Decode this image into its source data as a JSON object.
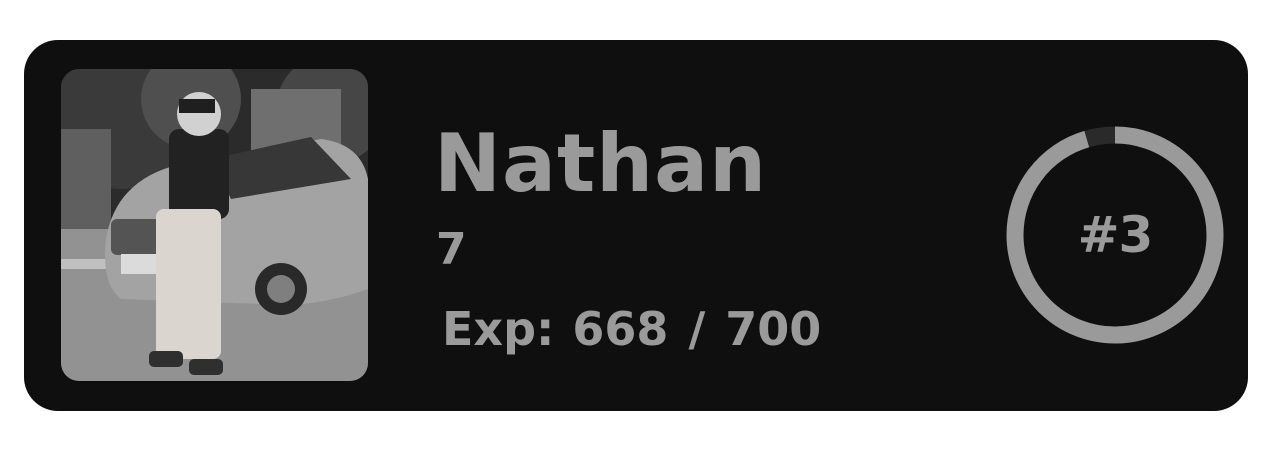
{
  "profile": {
    "name": "Nathan",
    "level": "7",
    "exp_label": "Exp:",
    "exp_value": "668 / 700"
  },
  "rank": {
    "label": "#3",
    "progress_fraction": 0.954
  },
  "colors": {
    "card_background": "#0f0f0f",
    "text": "#9a9a9a",
    "ring_progress": "#9a9a9a",
    "ring_track": "#2a2a2a"
  },
  "icons": {
    "avatar": "user-photo"
  }
}
